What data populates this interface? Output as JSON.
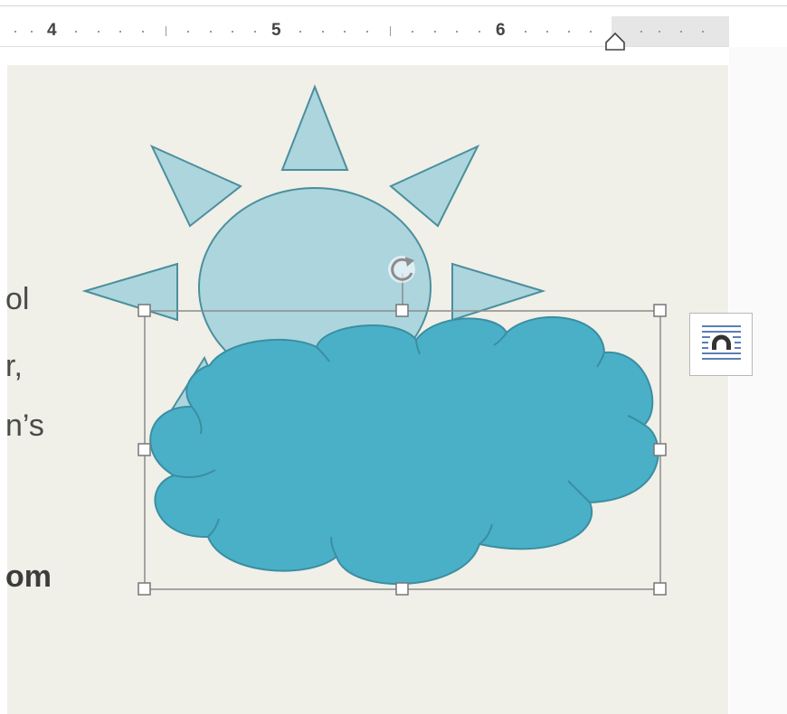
{
  "ruler": {
    "numbers": [
      "4",
      "5",
      "6"
    ]
  },
  "document": {
    "text_fragments": [
      "ol",
      "r,",
      "n’s",
      "om"
    ]
  },
  "icons": {
    "rotation_handle": "rotate-icon",
    "layout_options": "layout-options-icon",
    "indent_marker": "indent-marker-icon"
  },
  "colors": {
    "sun_fill": "#acd5de",
    "cloud_fill": "#4ab0c8",
    "stroke": "#4b8f9c",
    "page_bg": "#f0efe8"
  }
}
